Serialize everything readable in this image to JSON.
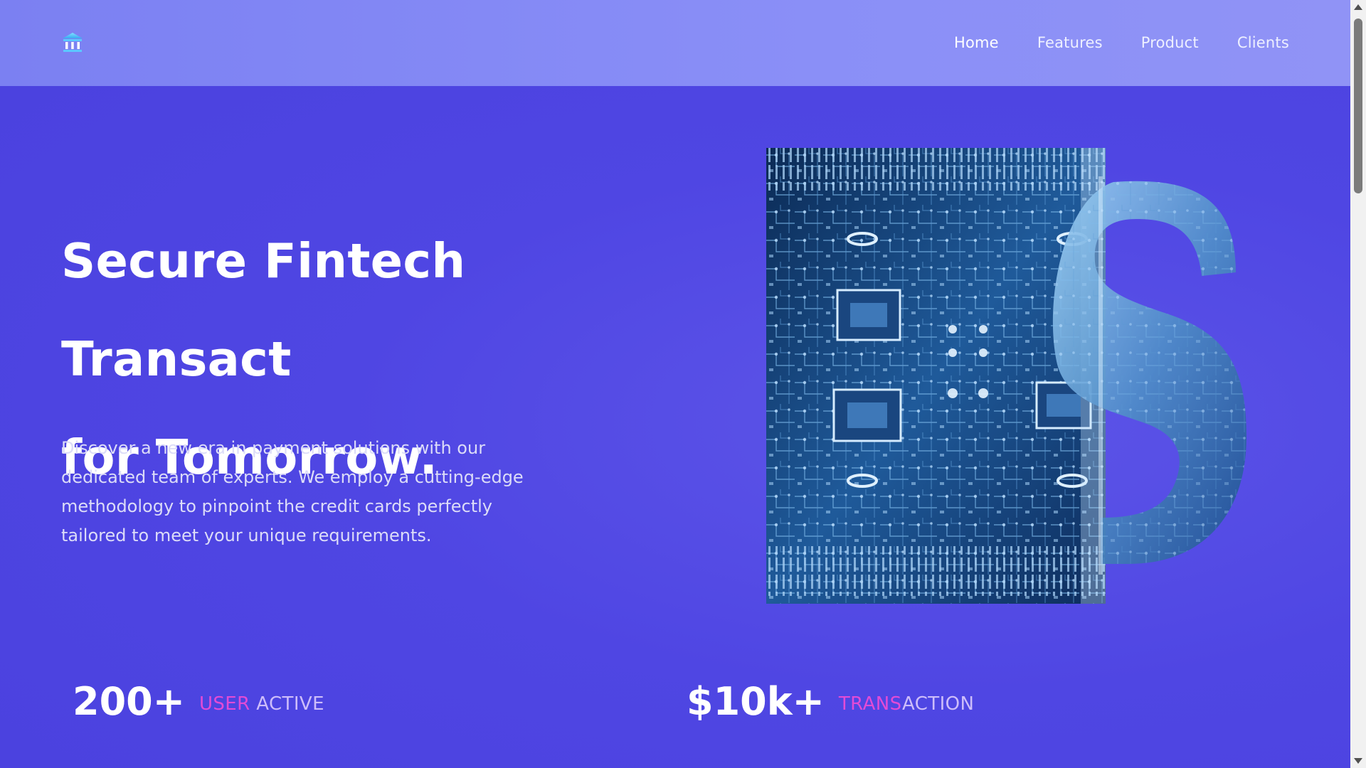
{
  "header": {
    "logo_icon": "bank-icon",
    "nav": [
      {
        "label": "Home",
        "active": true
      },
      {
        "label": "Features",
        "active": false
      },
      {
        "label": "Product",
        "active": false
      },
      {
        "label": "Clients",
        "active": false
      }
    ]
  },
  "hero": {
    "title_line1": "Secure Fintech Transact",
    "title_line2": "for Tomorrow.",
    "description": "Discover a new era in payment solutions with our dedicated team of experts. We employ a cutting-edge methodology to pinpoint the credit cards perfectly tailored to meet your unique requirements.",
    "image_icon": "circuit-dollar-image"
  },
  "stats": [
    {
      "value": "200+",
      "label_accent": "USER",
      "label_rest": " ACTIVE"
    },
    {
      "value": "$10k+",
      "label_accent": "TRANS",
      "label_rest": "ACTION"
    }
  ],
  "colors": {
    "background": "#4f46e3",
    "navbar": "#8a8ff7",
    "accent": "#e24bd6",
    "label_text": "#cdbdfa"
  }
}
